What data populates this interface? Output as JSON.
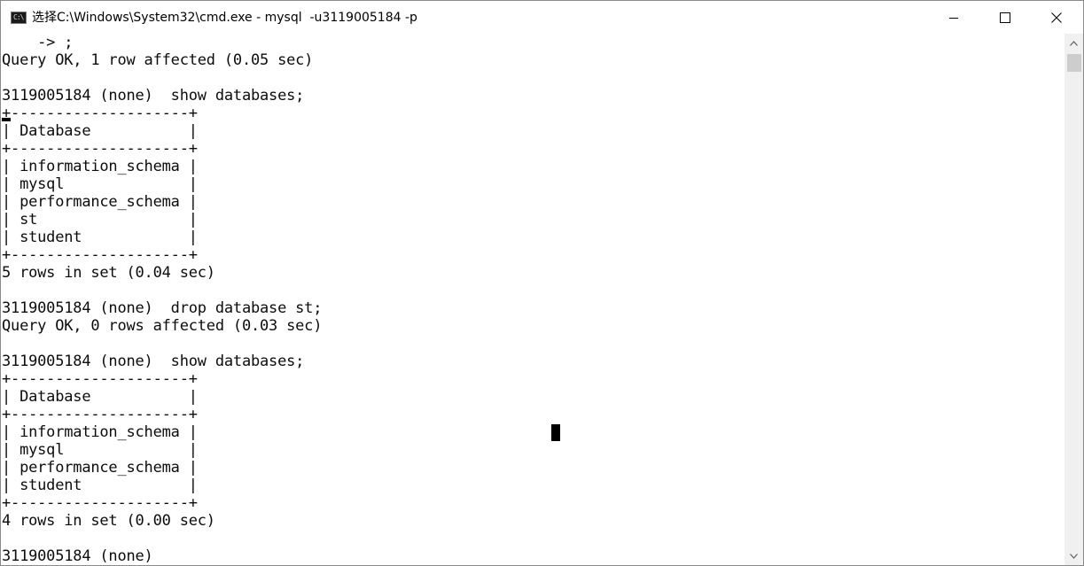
{
  "window": {
    "title": "选择C:\\Windows\\System32\\cmd.exe - mysql  -u3119005184 -p",
    "icon_text": "C:\\",
    "buttons": {
      "minimize": "minimize-icon",
      "maximize": "maximize-icon",
      "close": "close-icon"
    }
  },
  "console": {
    "lines": [
      "    -> ;",
      "Query OK, 1 row affected (0.05 sec)",
      "",
      "3119005184 (none)  show databases;",
      "+--------------------+",
      "| Database           |",
      "+--------------------+",
      "| information_schema |",
      "| mysql              |",
      "| performance_schema |",
      "| st                 |",
      "| student            |",
      "+--------------------+",
      "5 rows in set (0.04 sec)",
      "",
      "3119005184 (none)  drop database st;",
      "Query OK, 0 rows affected (0.03 sec)",
      "",
      "3119005184 (none)  show databases;",
      "+--------------------+",
      "| Database           |",
      "+--------------------+",
      "| information_schema |",
      "| mysql              |",
      "| performance_schema |",
      "| student            |",
      "+--------------------+",
      "4 rows in set (0.00 sec)",
      "",
      "3119005184 (none)"
    ]
  },
  "colors": {
    "background": "#ffffff",
    "text": "#0c0c0c",
    "scrollbar": "#f0f0f0",
    "scroll_thumb": "#cdcdcd"
  }
}
